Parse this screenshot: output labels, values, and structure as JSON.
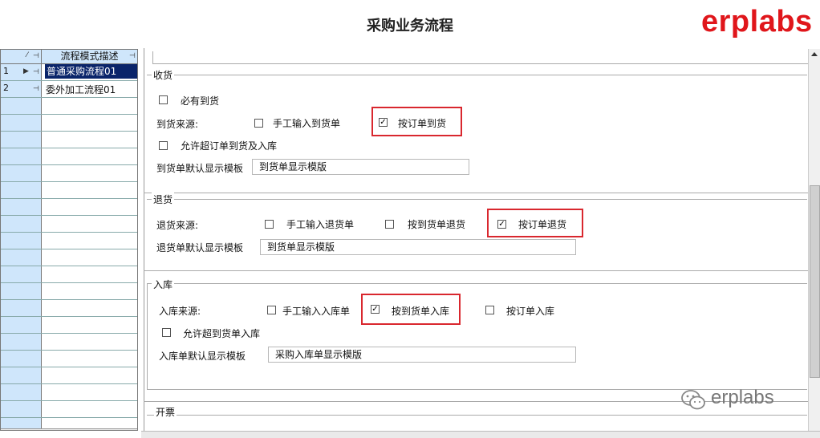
{
  "header": {
    "title": "采购业务流程",
    "brand": "erplabs"
  },
  "grid": {
    "column_header": "流程模式描述",
    "rows": [
      {
        "index": "1",
        "description": "普通采购流程01",
        "selected": true
      },
      {
        "index": "2",
        "description": "委外加工流程01",
        "selected": false
      }
    ]
  },
  "receive": {
    "title": "收货",
    "must_arrive": {
      "label": "必有到货",
      "checked": false
    },
    "source_label": "到货来源:",
    "manual": {
      "label": "手工输入到货单",
      "checked": false
    },
    "by_order": {
      "label": "按订单到货",
      "checked": true
    },
    "allow_over": {
      "label": "允许超订单到货及入库",
      "checked": false
    },
    "template_label": "到货单默认显示模板",
    "template_value": "到货单显示模版"
  },
  "returns": {
    "title": "退货",
    "source_label": "退货来源:",
    "manual": {
      "label": "手工输入退货单",
      "checked": false
    },
    "by_arrival": {
      "label": "按到货单退货",
      "checked": false
    },
    "by_order": {
      "label": "按订单退货",
      "checked": true
    },
    "template_label": "退货单默认显示模板",
    "template_value": "到货单显示模版"
  },
  "inbound": {
    "title": "入库",
    "source_label": "入库来源:",
    "manual": {
      "label": "手工输入入库单",
      "checked": false
    },
    "by_arrival": {
      "label": "按到货单入库",
      "checked": true
    },
    "by_order": {
      "label": "按订单入库",
      "checked": false
    },
    "allow_over": {
      "label": "允许超到货单入库",
      "checked": false
    },
    "template_label": "入库单默认显示模板",
    "template_value": "采购入库单显示模版"
  },
  "invoice": {
    "title": "开票"
  },
  "watermark": {
    "text": "erplabs"
  },
  "colors": {
    "highlight": "#d9272e",
    "brand": "#e0161b",
    "selection": "#0a246a",
    "grid_header": "#cfe6fb"
  }
}
